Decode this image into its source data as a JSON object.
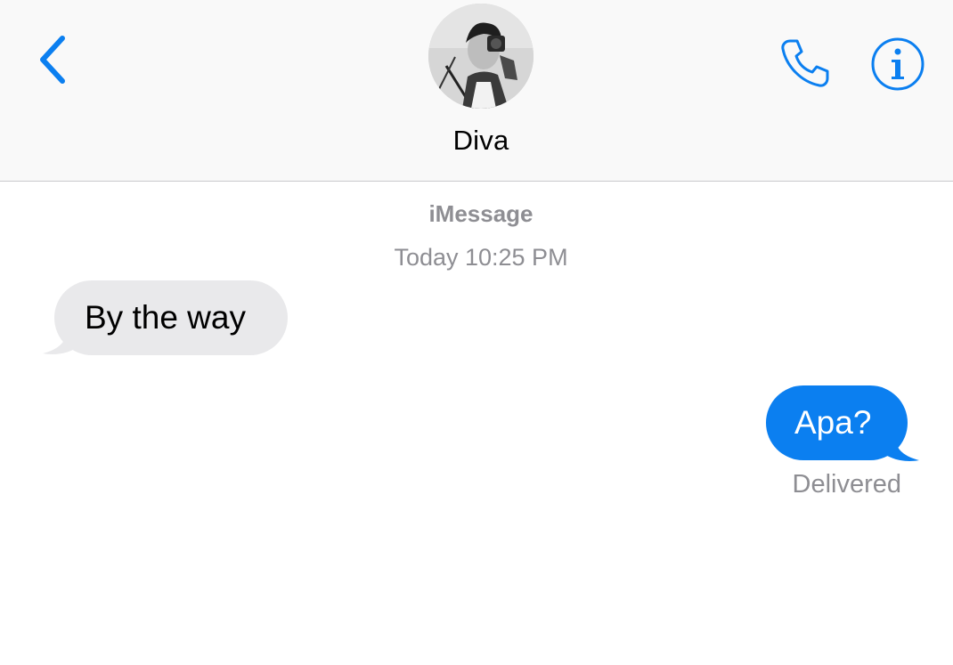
{
  "header": {
    "contact_name": "Diva",
    "back_icon": "chevron-left-icon",
    "call_icon": "phone-icon",
    "info_icon": "info-icon",
    "accent_color": "#0b7ff0"
  },
  "conversation": {
    "service_label": "iMessage",
    "timestamp": "Today 10:25 PM",
    "messages": [
      {
        "direction": "incoming",
        "text": "By the way",
        "bubble_color": "#e9e9eb"
      },
      {
        "direction": "outgoing",
        "text": "Apa?",
        "bubble_color": "#0b7ff0"
      }
    ],
    "delivery_status": "Delivered"
  }
}
